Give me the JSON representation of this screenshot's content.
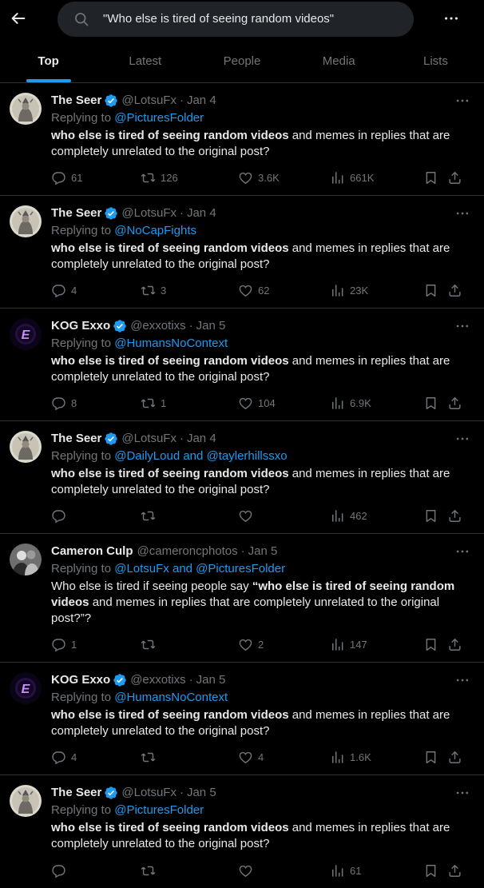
{
  "search": {
    "query": "\"Who else is tired of seeing random videos\""
  },
  "tabs": [
    {
      "label": "Top",
      "active": true
    },
    {
      "label": "Latest",
      "active": false
    },
    {
      "label": "People",
      "active": false
    },
    {
      "label": "Media",
      "active": false
    },
    {
      "label": "Lists",
      "active": false
    }
  ],
  "colors": {
    "accent": "#1d9bf0",
    "muted": "#71767b",
    "text": "#e7e9ea",
    "border": "#2f3336"
  },
  "icons": [
    "back-arrow-icon",
    "search-icon",
    "more-icon",
    "verified-icon",
    "reply-icon",
    "retweet-icon",
    "like-icon",
    "views-icon",
    "bookmark-icon",
    "share-icon"
  ],
  "tweets": [
    {
      "name": "The Seer",
      "verified": true,
      "handle": "@LotsuFx",
      "date": "Jan 4",
      "replying_prefix": "Replying to ",
      "replying_to": "@PicturesFolder",
      "text_prefix": "",
      "text_bold": "who else is tired of seeing random videos",
      "text_suffix": " and memes in replies that are completely unrelated to the original post?",
      "replies": "61",
      "retweets": "126",
      "likes": "3.6K",
      "views": "661K"
    },
    {
      "name": "The Seer",
      "verified": true,
      "handle": "@LotsuFx",
      "date": "Jan 4",
      "replying_prefix": "Replying to ",
      "replying_to": "@NoCapFights",
      "text_prefix": "",
      "text_bold": "who else is tired of seeing random videos",
      "text_suffix": " and memes in replies that are completely unrelated to the original post?",
      "replies": "4",
      "retweets": "3",
      "likes": "62",
      "views": "23K"
    },
    {
      "name": "KOG Exxo",
      "verified": true,
      "handle": "@exxotixs",
      "date": "Jan 5",
      "replying_prefix": "Replying to ",
      "replying_to": "@HumansNoContext",
      "text_prefix": "",
      "text_bold": "who else is tired of seeing random videos",
      "text_suffix": " and memes in replies that are completely unrelated to the original post?",
      "replies": "8",
      "retweets": "1",
      "likes": "104",
      "views": "6.9K"
    },
    {
      "name": "The Seer",
      "verified": true,
      "handle": "@LotsuFx",
      "date": "Jan 4",
      "replying_prefix": "Replying to ",
      "replying_to": "@DailyLoud and @taylerhillssxo",
      "text_prefix": "",
      "text_bold": "who else is tired of seeing random videos",
      "text_suffix": " and memes in replies that are completely unrelated to the original post?",
      "replies": "",
      "retweets": "",
      "likes": "",
      "views": "462"
    },
    {
      "name": "Cameron Culp",
      "verified": false,
      "handle": "@cameroncphotos",
      "date": "Jan 5",
      "replying_prefix": "Replying to ",
      "replying_to": "@LotsuFx and @PicturesFolder",
      "text_prefix": "Who else is tired if seeing people say ",
      "text_bold": "“who else is tired of seeing random videos",
      "text_suffix": " and memes in replies that are completely unrelated to the original post?”?",
      "replies": "1",
      "retweets": "",
      "likes": "2",
      "views": "147"
    },
    {
      "name": "KOG Exxo",
      "verified": true,
      "handle": "@exxotixs",
      "date": "Jan 5",
      "replying_prefix": "Replying to ",
      "replying_to": "@HumansNoContext",
      "text_prefix": "",
      "text_bold": "who else is tired of seeing random videos",
      "text_suffix": " and memes in replies that are completely unrelated to the original post?",
      "replies": "4",
      "retweets": "",
      "likes": "4",
      "views": "1.6K"
    },
    {
      "name": "The Seer",
      "verified": true,
      "handle": "@LotsuFx",
      "date": "Jan 5",
      "replying_prefix": "Replying to ",
      "replying_to": "@PicturesFolder",
      "text_prefix": "",
      "text_bold": "who else is tired of seeing random videos",
      "text_suffix": " and memes in replies that are completely unrelated to the original post?",
      "replies": "",
      "retweets": "",
      "likes": "",
      "views": "61"
    }
  ]
}
